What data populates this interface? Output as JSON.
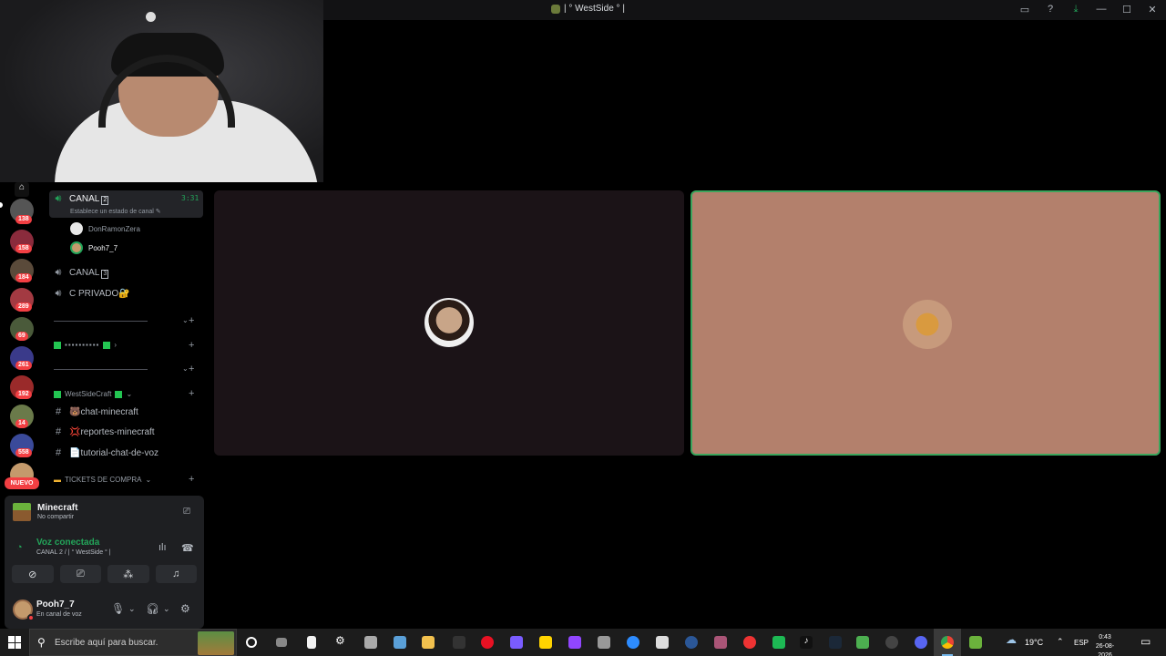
{
  "window": {
    "title": "| ° WestSide ° |"
  },
  "channels": {
    "active_voice": {
      "name": "CANAL",
      "count": "2",
      "status_hint": "Establece un estado de canal",
      "timer": "3:31"
    },
    "members": [
      {
        "name": "DonRamonZera"
      },
      {
        "name": "Pooh7_7"
      }
    ],
    "voice_channels": [
      {
        "name": "CANAL",
        "count": "3"
      },
      {
        "name": "C PRIVADO🔐"
      }
    ],
    "categories": [
      {
        "name": "WestSideCraft"
      },
      {
        "name": "TICKETS DE COMPRA"
      }
    ],
    "text_channels": [
      {
        "name": "🐻chat-minecraft"
      },
      {
        "name": "💢reportes-minecraft"
      },
      {
        "name": "📄tutorial-chat-de-voz"
      }
    ]
  },
  "server_badges": [
    "138",
    "158",
    "184",
    "289",
    "69",
    "261",
    "192",
    "14",
    "558"
  ],
  "new_label": "NUEVO",
  "activity": {
    "title": "Minecraft",
    "subtitle": "No compartir"
  },
  "voice": {
    "title": "Voz conectada",
    "subtitle": "CANAL 2 / | ° WestSide ° |"
  },
  "user": {
    "name": "Pooh7_7",
    "status": "En canal de voz"
  },
  "taskbar": {
    "search_placeholder": "Escribe aquí para buscar.",
    "weather": "19°C",
    "language": "ESP",
    "time": "0:43",
    "date": "26-08-2026"
  },
  "colors": {
    "accent_green": "#23a55a",
    "badge_red": "#f23f43",
    "tile_speaking_border": "#3ba55c",
    "tile_b_bg": "#b3806c",
    "tile_a_bg": "#1b1317"
  }
}
